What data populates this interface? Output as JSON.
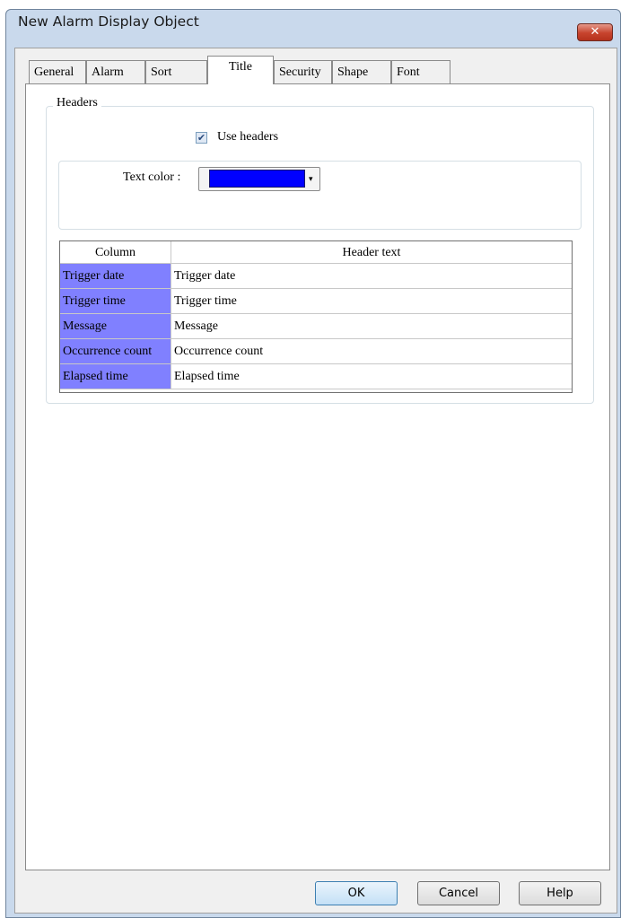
{
  "window": {
    "title": "New Alarm Display Object",
    "close_glyph": "✕"
  },
  "tabs": [
    {
      "label": "General",
      "active": false
    },
    {
      "label": "Alarm",
      "active": false
    },
    {
      "label": "Sort",
      "active": false
    },
    {
      "label": "Title",
      "active": true
    },
    {
      "label": "Security",
      "active": false
    },
    {
      "label": "Shape",
      "active": false
    },
    {
      "label": "Font",
      "active": false
    }
  ],
  "headers_group": {
    "legend": "Headers",
    "use_headers_label": "Use headers",
    "use_headers_checked": true,
    "check_glyph": "✔",
    "text_color_label": "Text color :",
    "text_color_value": "#0000ff",
    "dropdown_glyph": "▾"
  },
  "table": {
    "columns": [
      "Column",
      "Header text"
    ],
    "rows": [
      {
        "column": "Trigger date",
        "header_text": "Trigger date"
      },
      {
        "column": "Trigger time",
        "header_text": "Trigger time"
      },
      {
        "column": "Message",
        "header_text": "Message"
      },
      {
        "column": "Occurrence count",
        "header_text": "Occurrence count"
      },
      {
        "column": "Elapsed time",
        "header_text": "Elapsed time"
      }
    ],
    "row_label_bg": "#8080ff"
  },
  "buttons": {
    "ok": "OK",
    "cancel": "Cancel",
    "help": "Help"
  }
}
